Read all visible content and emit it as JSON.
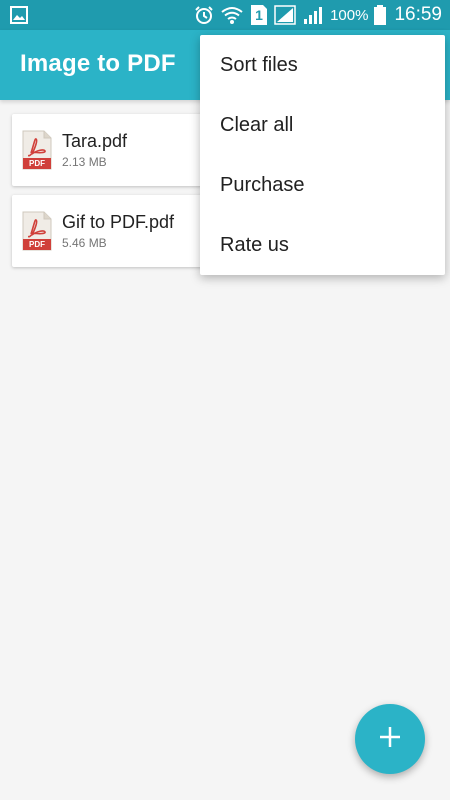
{
  "colors": {
    "status_bar": "#1f9bae",
    "toolbar": "#2bb3c7",
    "accent": "#2bb3c7",
    "pdf_red": "#d0403a",
    "background": "#f5f5f5"
  },
  "status_bar": {
    "icons": [
      "gallery-notification-icon",
      "alarm-icon",
      "wifi-icon",
      "sim-1-icon",
      "signal-icon",
      "signal-icon",
      "battery-icon"
    ],
    "sim_label": "1",
    "battery_text": "100%",
    "time": "16:59"
  },
  "toolbar": {
    "title": "Image to PDF"
  },
  "files": [
    {
      "name": "Tara.pdf",
      "size": "2.13 MB",
      "icon": "pdf-file-icon",
      "icon_label": "PDF"
    },
    {
      "name": "Gif to PDF.pdf",
      "size": "5.46 MB",
      "icon": "pdf-file-icon",
      "icon_label": "PDF"
    }
  ],
  "menu": {
    "items": [
      {
        "label": "Sort files"
      },
      {
        "label": "Clear all"
      },
      {
        "label": "Purchase"
      },
      {
        "label": "Rate us"
      }
    ]
  },
  "fab": {
    "icon": "plus-icon",
    "symbol": "+"
  }
}
